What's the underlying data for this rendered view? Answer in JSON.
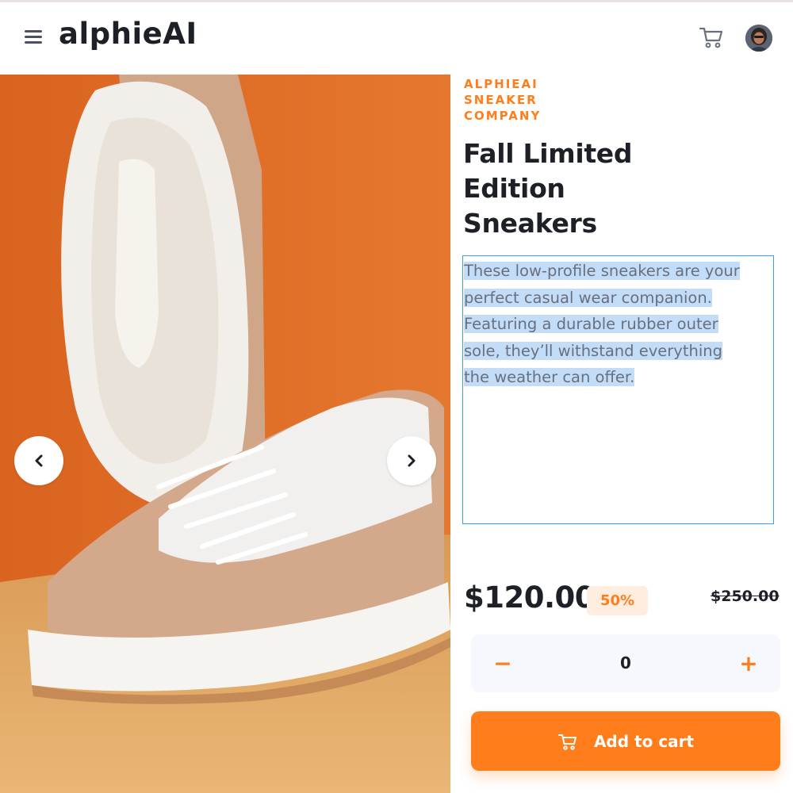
{
  "header": {
    "brand": "alphieAI",
    "menu_icon": "hamburger-menu-icon",
    "cart_icon": "cart-icon",
    "avatar_icon": "user-avatar"
  },
  "gallery": {
    "prev_icon": "chevron-left-icon",
    "next_icon": "chevron-right-icon",
    "product_image": "sneaker-product-photo"
  },
  "product": {
    "company_lines": [
      "ALPHIEAI",
      "SNEAKER",
      "COMPANY"
    ],
    "title_lines": [
      "Fall Limited",
      "Edition",
      "Sneakers"
    ],
    "description_lines": [
      "These low-profile sneakers are your",
      "perfect casual wear companion.",
      "Featuring a durable rubber outer",
      "sole, they’ll withstand everything",
      "the weather can offer."
    ],
    "price": "$120.00",
    "discount": "50%",
    "old_price": "$250.00"
  },
  "quantity": {
    "minus_label": "−",
    "value": "0",
    "plus_label": "+"
  },
  "cart_button": {
    "label": "Add to cart",
    "icon": "cart-icon"
  },
  "colors": {
    "accent": "#ff7e1b",
    "accent_light": "#ffede0",
    "text_dark": "#1d2026",
    "text_gray": "#68707d",
    "selection": "#c3ddf9",
    "selection_border": "#3a9ff0"
  }
}
